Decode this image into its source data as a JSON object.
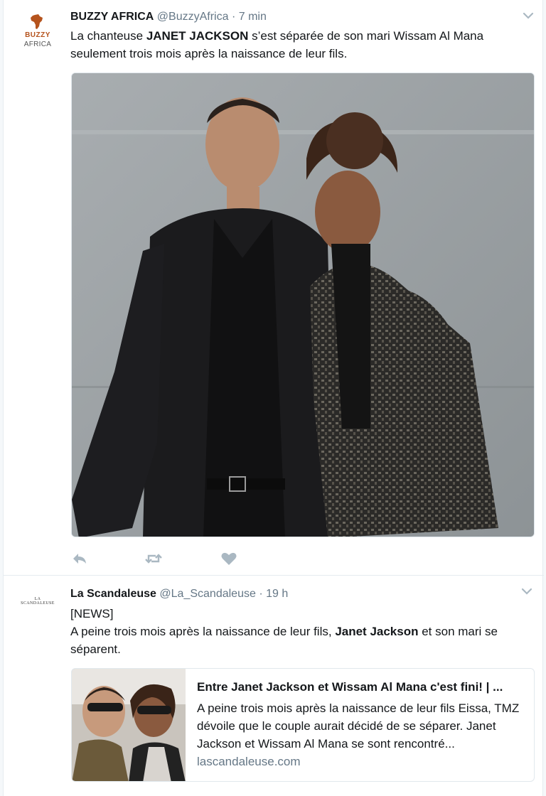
{
  "colors": {
    "background": "#ffffff",
    "text": "#14171a",
    "secondary": "#657786",
    "border": "#e6ecf0",
    "icon": "#aab8c2",
    "buzzy_brand": "#b5531d"
  },
  "tweets": [
    {
      "avatar": {
        "brand_line1": "BUZZY",
        "brand_line2": "AFRICA",
        "icon": "africa-map-icon"
      },
      "fullname": "BUZZY AFRICA",
      "screen_name": "@BuzzyAfrica",
      "separator": "·",
      "time": "7 min",
      "text": {
        "part1": "La chanteuse ",
        "bold1": "JANET JACKSON",
        "part2": " s’est séparée de son mari Wissam Al Mana seulement trois mois après la naissance de leur fils."
      },
      "actions": {
        "reply_icon": "reply-icon",
        "retweet_icon": "retweet-icon",
        "like_icon": "heart-icon"
      }
    },
    {
      "avatar": {
        "logo_text": "LA SCANDALEUSE"
      },
      "fullname": "La Scandaleuse",
      "screen_name": "@La_Scandaleuse",
      "separator": "·",
      "time": "19 h",
      "text": {
        "line1": "[NEWS]",
        "part1": "A peine trois mois après la naissance de leur fils, ",
        "bold1": "Janet Jackson",
        "part2": " et son mari se séparent."
      },
      "card": {
        "title": "Entre Janet Jackson et Wissam Al Mana c'est fini! | ...",
        "description": "A peine trois mois après la naissance de leur fils Eissa, TMZ dévoile que le couple aurait décidé de se séparer. Janet Jackson et Wissam Al Mana se sont rencontré...",
        "domain": "lascandaleuse.com"
      }
    }
  ]
}
